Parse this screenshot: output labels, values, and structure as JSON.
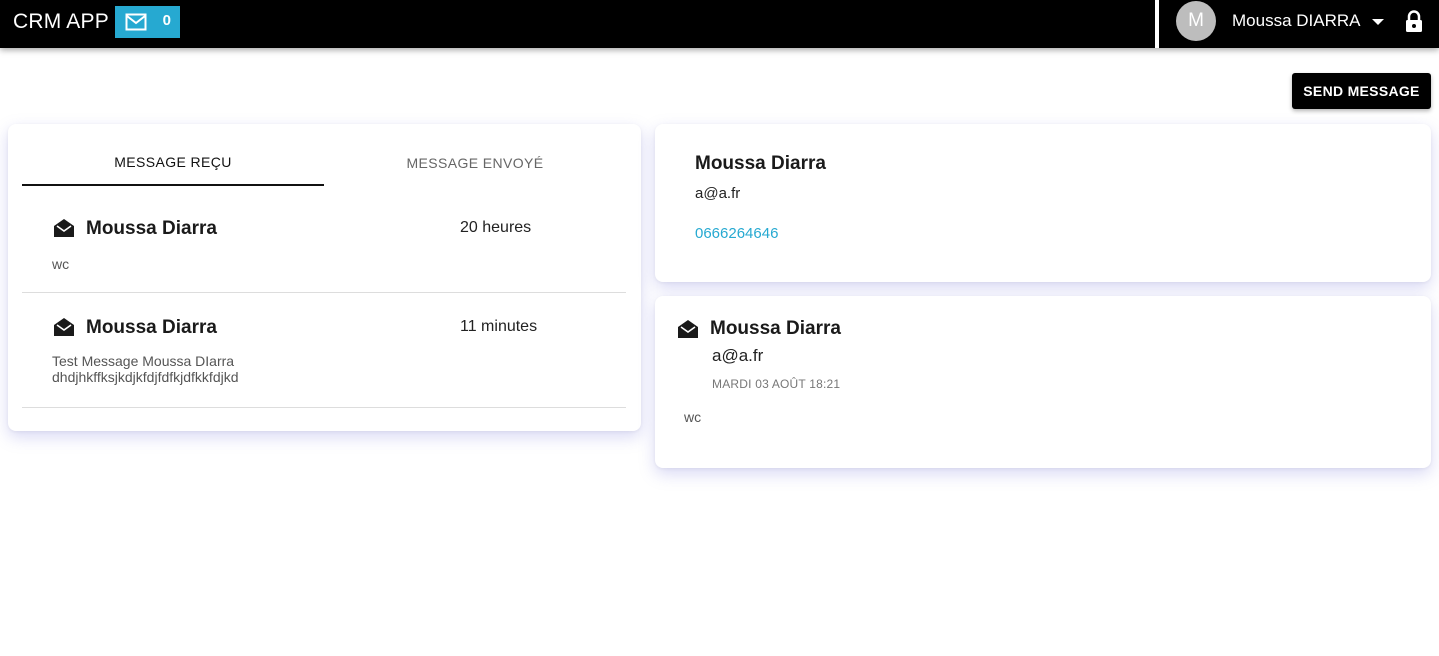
{
  "app": {
    "title": "CRM APP"
  },
  "header": {
    "mail_count": "0",
    "avatar_initial": "M",
    "user_name": "Moussa DIARRA",
    "icons": {
      "mail": "mail-icon",
      "dropdown": "chevron-down-icon",
      "lock": "lock-icon"
    }
  },
  "toolbar": {
    "send_label": "SEND MESSAGE"
  },
  "tabs": [
    {
      "label": "MESSAGE REÇU",
      "active": true
    },
    {
      "label": "MESSAGE ENVOYÉ",
      "active": false
    }
  ],
  "messages": [
    {
      "sender": "Moussa Diarra",
      "time": "20 heures",
      "body_lines": [
        "wc"
      ]
    },
    {
      "sender": "Moussa Diarra",
      "time": "11 minutes",
      "body_lines": [
        "Test Message Moussa DIarra",
        "dhdjhkffksjkdjkfdjfdfkjdfkkfdjkd"
      ]
    }
  ],
  "contact": {
    "name": "Moussa Diarra",
    "email": "a@a.fr",
    "phone": "0666264646"
  },
  "detail": {
    "sender": "Moussa Diarra",
    "email": "a@a.fr",
    "date": "MARDI 03 AOÛT 18:21",
    "body": "wc"
  },
  "colors": {
    "accent": "#26a9d1",
    "topbar": "#000000"
  }
}
